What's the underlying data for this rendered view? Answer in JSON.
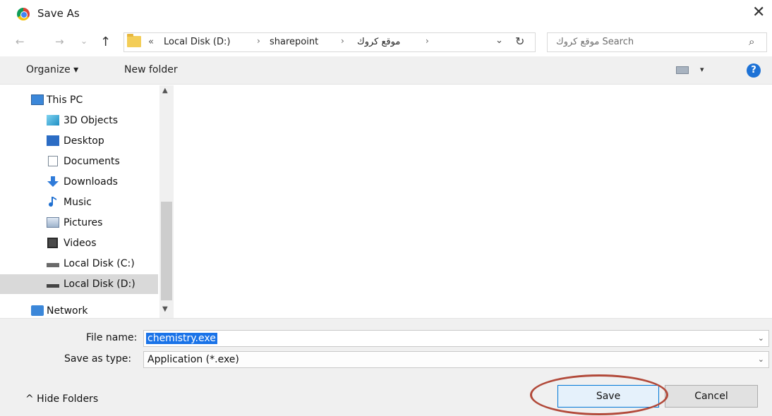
{
  "window": {
    "title": "Save As",
    "close_glyph": "✕",
    "app_icon": "chrome-icon"
  },
  "nav": {
    "back_glyph": "←",
    "forward_glyph": "→",
    "recent_glyph": "⌄",
    "up_glyph": "↑",
    "breadcrumb": {
      "overflow": "«",
      "items": [
        "Local Disk (D:)",
        "sharepoint",
        "موقع كروك"
      ],
      "separator": "›",
      "dropdown_glyph": "⌄",
      "refresh_glyph": "↻"
    },
    "search": {
      "placeholder": "موقع كروك Search",
      "icon_glyph": "⌕"
    }
  },
  "toolbar": {
    "organize_label": "Organize ▾",
    "new_folder_label": "New folder",
    "view_caret": "▾",
    "help_glyph": "?"
  },
  "sidebar": {
    "items": [
      {
        "label": "This PC",
        "icon": "this-pc-icon",
        "color": "#3b87d9"
      },
      {
        "label": "3D Objects",
        "icon": "3d-objects-icon",
        "color": "#3fa9d6"
      },
      {
        "label": "Desktop",
        "icon": "desktop-icon",
        "color": "#2b6cc4"
      },
      {
        "label": "Documents",
        "icon": "documents-icon",
        "color": "#9aa5b1"
      },
      {
        "label": "Downloads",
        "icon": "downloads-icon",
        "color": "#2f7bd9"
      },
      {
        "label": "Music",
        "icon": "music-icon",
        "color": "#1e6fd0"
      },
      {
        "label": "Pictures",
        "icon": "pictures-icon",
        "color": "#5e86b8"
      },
      {
        "label": "Videos",
        "icon": "videos-icon",
        "color": "#4a4a4a"
      },
      {
        "label": "Local Disk (C:)",
        "icon": "local-disk-c-icon",
        "color": "#6a6a6a"
      },
      {
        "label": "Local Disk (D:)",
        "icon": "local-disk-d-icon",
        "color": "#444444",
        "selected": true
      },
      {
        "label": "Network",
        "icon": "network-icon",
        "color": "#3b87d9"
      }
    ],
    "scroll_up_glyph": "▲",
    "scroll_down_glyph": "▼"
  },
  "form": {
    "file_name_label": "File name:",
    "file_name_value": "chemistry.exe",
    "save_as_type_label": "Save as type:",
    "save_as_type_value": "Application (*.exe)",
    "dropdown_glyph": "⌄"
  },
  "footer": {
    "hide_folders_label": "^  Hide Folders",
    "save_label": "Save",
    "cancel_label": "Cancel"
  },
  "colors": {
    "selection_blue": "#1a73e8",
    "annotation_ring": "#b24a3a",
    "help_blue": "#1d72d6"
  }
}
